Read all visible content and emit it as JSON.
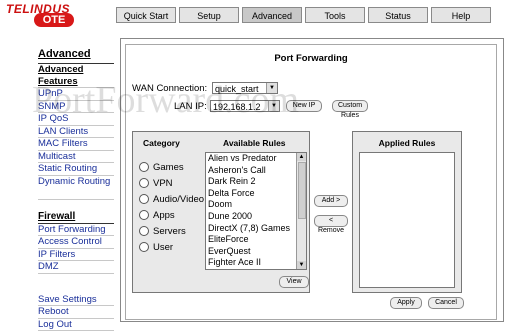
{
  "logo": {
    "line1": "TELINDUS",
    "line2": "OTE"
  },
  "nav": [
    {
      "label": "Quick Start",
      "active": false
    },
    {
      "label": "Setup",
      "active": false
    },
    {
      "label": "Advanced",
      "active": true
    },
    {
      "label": "Tools",
      "active": false
    },
    {
      "label": "Status",
      "active": false
    },
    {
      "label": "Help",
      "active": false
    }
  ],
  "sidebar": {
    "title": "Advanced",
    "items": [
      "Advanced Features",
      "UPnP",
      "SNMP",
      "IP QoS",
      "LAN Clients",
      "MAC Filters",
      "Multicast",
      "Static Routing",
      "Dynamic Routing"
    ],
    "firewall_title": "Firewall",
    "firewall_items": [
      "Port Forwarding",
      "Access Control",
      "IP Filters",
      "DMZ"
    ],
    "bottom_items": [
      "Save Settings",
      "Reboot",
      "Log Out"
    ]
  },
  "page": {
    "title": "Port Forwarding",
    "wan_label": "WAN Connection:",
    "wan_value": "quick_start",
    "lan_label": "LAN IP:",
    "lan_value": "192.168.1.2",
    "new_ip": "New IP",
    "custom_rules": "Custom Rules",
    "category_header": "Category",
    "available_header": "Available Rules",
    "applied_header": "Applied Rules",
    "categories": [
      "Games",
      "VPN",
      "Audio/Video",
      "Apps",
      "Servers",
      "User"
    ],
    "rules": [
      "Alien vs Predator",
      "Asheron's Call",
      "Dark Rein 2",
      "Delta Force",
      "Doom",
      "Dune 2000",
      "DirectX (7,8) Games",
      "EliteForce",
      "EverQuest",
      "Fighter Ace II"
    ],
    "add": "Add >",
    "remove": "< Remove",
    "view": "View",
    "apply": "Apply",
    "cancel": "Cancel"
  },
  "watermark": "PortForward.com"
}
